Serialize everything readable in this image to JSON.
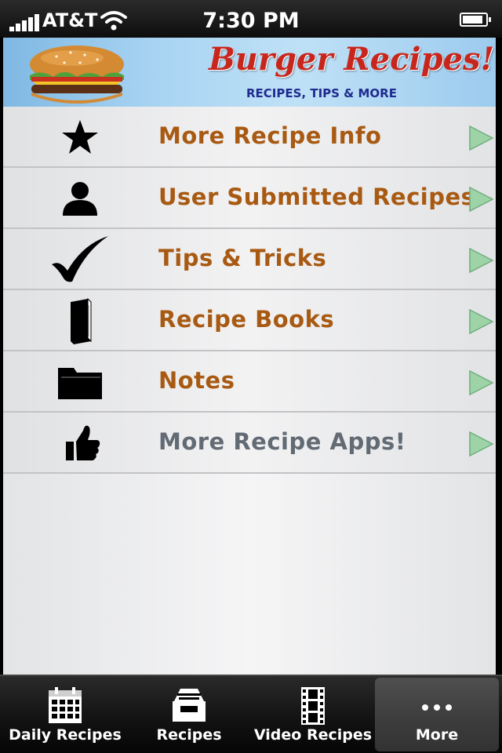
{
  "status_bar": {
    "carrier": "AT&T",
    "time": "7:30 PM",
    "battery_level": 0.9
  },
  "banner": {
    "title": "Burger Recipes!",
    "subtitle": "RECIPES, TIPS & MORE"
  },
  "menu": {
    "items": [
      {
        "label": "More Recipe Info",
        "icon": "star-icon",
        "color": "#a85a12"
      },
      {
        "label": "User Submitted Recipes",
        "icon": "user-icon",
        "color": "#a85a12"
      },
      {
        "label": "Tips & Tricks",
        "icon": "checkmark-icon",
        "color": "#a85a12"
      },
      {
        "label": "Recipe Books",
        "icon": "book-icon",
        "color": "#a85a12"
      },
      {
        "label": "Notes",
        "icon": "folder-icon",
        "color": "#a85a12"
      },
      {
        "label": "More Recipe Apps!",
        "icon": "thumbs-up-icon",
        "color": "#626a74"
      }
    ]
  },
  "tab_bar": {
    "tabs": [
      {
        "label": "Daily Recipes",
        "icon": "calendar-icon",
        "active": false
      },
      {
        "label": "Recipes",
        "icon": "inbox-tray-icon",
        "active": false
      },
      {
        "label": "Video Recipes",
        "icon": "film-strip-icon",
        "active": false
      },
      {
        "label": "More",
        "icon": "more-dots-icon",
        "active": true
      }
    ]
  },
  "colors": {
    "accent_label": "#a85a12",
    "secondary_label": "#626a74",
    "chevron": "#9ed3a8",
    "banner_title": "#c8261d",
    "banner_subtitle": "#1f2b8f"
  }
}
